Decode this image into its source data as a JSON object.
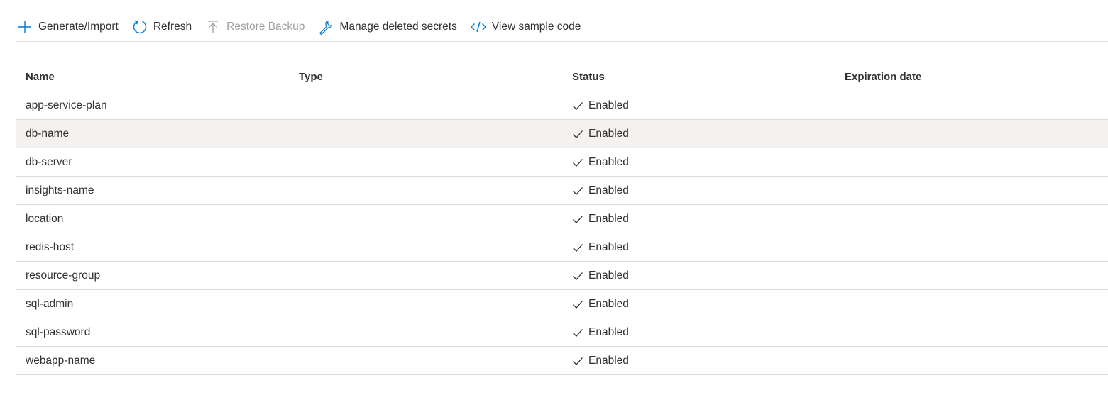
{
  "toolbar": {
    "generate_import": {
      "label": "Generate/Import",
      "icon": "plus-icon"
    },
    "refresh": {
      "label": "Refresh",
      "icon": "refresh-icon"
    },
    "restore_backup": {
      "label": "Restore Backup",
      "icon": "upload-icon",
      "disabled": true
    },
    "manage_deleted": {
      "label": "Manage deleted secrets",
      "icon": "wrench-icon"
    },
    "sample_code": {
      "label": "View sample code",
      "icon": "code-icon"
    }
  },
  "table": {
    "headers": {
      "name": "Name",
      "type": "Type",
      "status": "Status",
      "expiration": "Expiration date"
    },
    "rows": [
      {
        "name": "app-service-plan",
        "type": "",
        "status": "Enabled",
        "expiration": ""
      },
      {
        "name": "db-name",
        "type": "",
        "status": "Enabled",
        "expiration": ""
      },
      {
        "name": "db-server",
        "type": "",
        "status": "Enabled",
        "expiration": ""
      },
      {
        "name": "insights-name",
        "type": "",
        "status": "Enabled",
        "expiration": ""
      },
      {
        "name": "location",
        "type": "",
        "status": "Enabled",
        "expiration": ""
      },
      {
        "name": "redis-host",
        "type": "",
        "status": "Enabled",
        "expiration": ""
      },
      {
        "name": "resource-group",
        "type": "",
        "status": "Enabled",
        "expiration": ""
      },
      {
        "name": "sql-admin",
        "type": "",
        "status": "Enabled",
        "expiration": ""
      },
      {
        "name": "sql-password",
        "type": "",
        "status": "Enabled",
        "expiration": ""
      },
      {
        "name": "webapp-name",
        "type": "",
        "status": "Enabled",
        "expiration": ""
      }
    ],
    "selected_row": 1
  },
  "colors": {
    "accent": "#0078d4",
    "text": "#323130",
    "disabled": "#a19f9d",
    "selected_row_bg": "#f3f2f1"
  }
}
